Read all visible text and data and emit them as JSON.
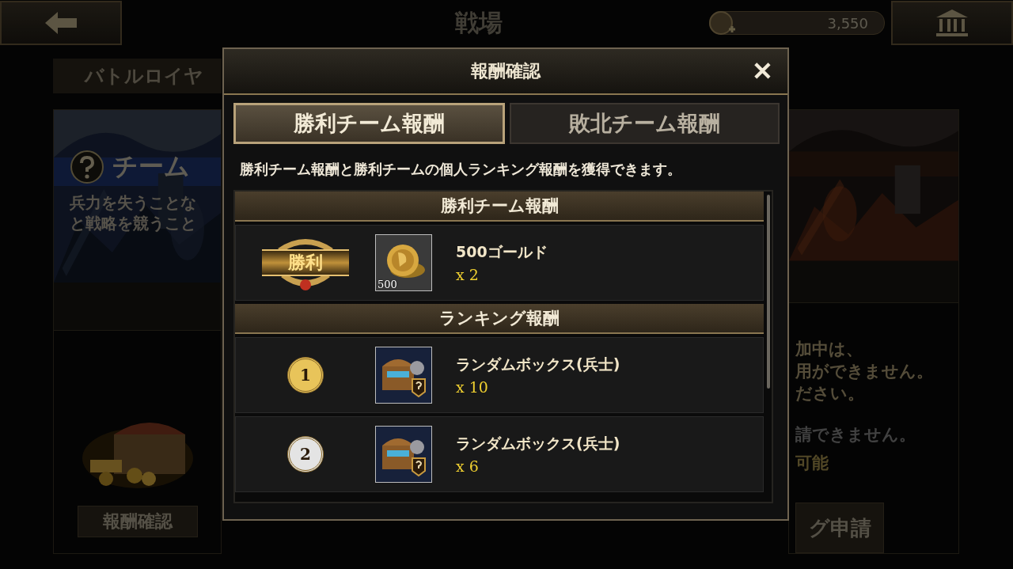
{
  "top_bar": {
    "title": "戦場",
    "currency": "3,550"
  },
  "background": {
    "tab": "バトルロイヤ",
    "left_panel": {
      "heading": "チーム",
      "description": [
        "兵力を失うことな",
        "と戦略を競うこと"
      ],
      "button": "報酬確認"
    },
    "right_panel": {
      "lines": [
        {
          "text": "加中は、",
          "kind": "note"
        },
        {
          "text": "用ができません。",
          "kind": "note"
        },
        {
          "text": "ださい。",
          "kind": "note"
        },
        {
          "text": "請できません。",
          "kind": "muted"
        },
        {
          "text": "可能",
          "kind": "status"
        }
      ],
      "button": "グ申請"
    }
  },
  "dialog": {
    "title": "報酬確認",
    "close": "✕",
    "tabs": [
      {
        "label": "勝利チーム報酬",
        "selected": true
      },
      {
        "label": "敗北チーム報酬",
        "selected": false
      }
    ],
    "description": "勝利チーム報酬と勝利チームの個人ランキング報酬を獲得できます。",
    "sections": [
      {
        "title": "勝利チーム報酬",
        "rows": [
          {
            "kind": "victory",
            "badge": "勝利",
            "item": {
              "kind": "gold",
              "name": "500ゴールド",
              "count": "x 2",
              "overlay": "500"
            }
          }
        ]
      },
      {
        "title": "ランキング報酬",
        "rows": [
          {
            "kind": "rank",
            "rank": "1",
            "color": "#e8c45a",
            "item": {
              "kind": "box",
              "name": "ランダムボックス(兵士)",
              "count": "x 10"
            }
          },
          {
            "kind": "rank",
            "rank": "2",
            "color": "#e4e4e4",
            "item": {
              "kind": "box",
              "name": "ランダムボックス(兵士)",
              "count": "x 6"
            }
          }
        ]
      }
    ]
  }
}
